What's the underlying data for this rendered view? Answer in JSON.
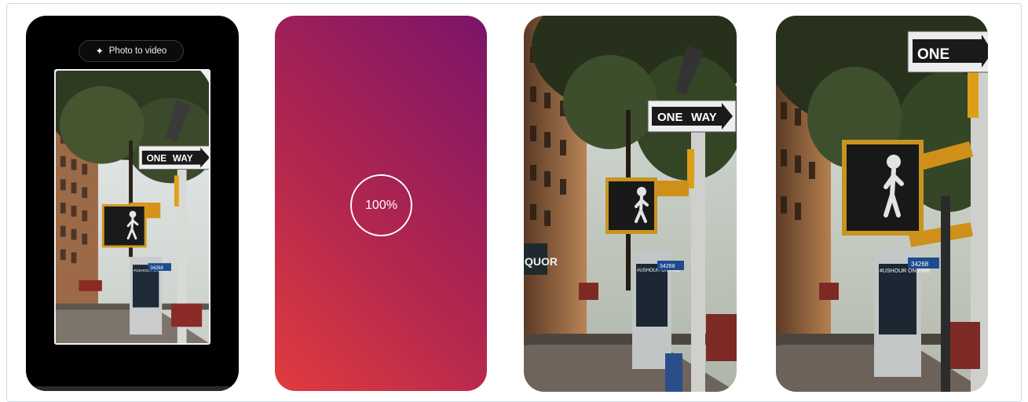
{
  "editor": {
    "pill_icon": "sparkle-icon",
    "pill_label": "Photo to video"
  },
  "progress": {
    "label": "100%",
    "gradient_colors": [
      "#e13b3e",
      "#b0264f",
      "#7b1469"
    ]
  },
  "street_scene": {
    "one_way_text_left": "ONE",
    "one_way_text_right": "WAY",
    "storefront_sign": "QUOR",
    "kiosk_text": "#USHOUR ON FIRE",
    "street_plate": "34268"
  }
}
